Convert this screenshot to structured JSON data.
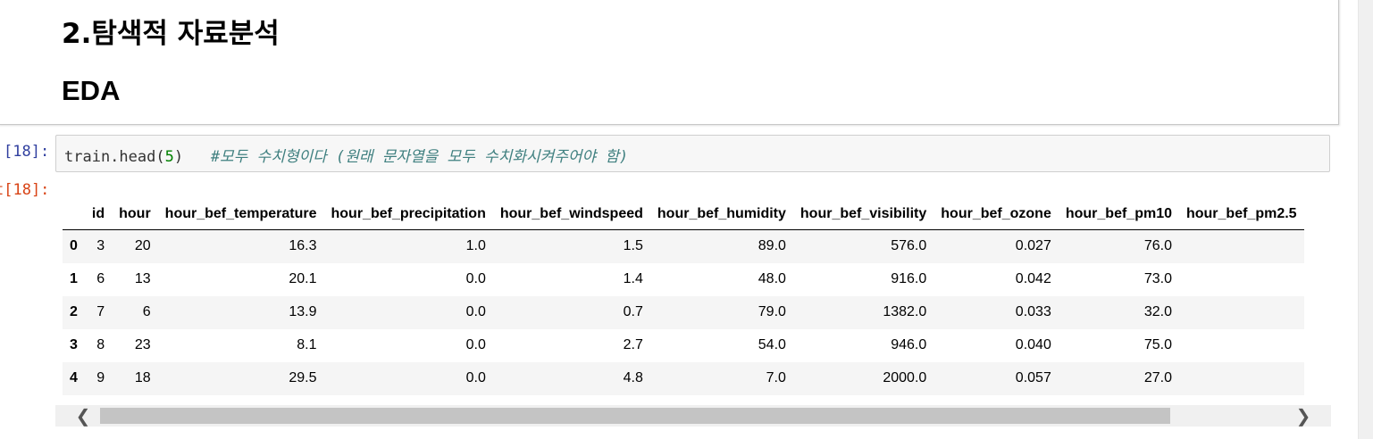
{
  "markdown": {
    "heading1": "2.탐색적 자료분석",
    "heading2": "EDA"
  },
  "input_cell": {
    "prompt": "[18]:",
    "code_prefix": "train.head(",
    "code_arg": "5",
    "code_suffix": ")",
    "code_comment": "#모두 수치형이다 (원래 문자열을 모두 수치화시켜주어야 함)"
  },
  "output_cell": {
    "prompt": "t[18]:"
  },
  "table": {
    "columns": [
      "",
      "id",
      "hour",
      "hour_bef_temperature",
      "hour_bef_precipitation",
      "hour_bef_windspeed",
      "hour_bef_humidity",
      "hour_bef_visibility",
      "hour_bef_ozone",
      "hour_bef_pm10",
      "hour_bef_pm2.5"
    ],
    "rows": [
      [
        "0",
        "3",
        "20",
        "16.3",
        "1.0",
        "1.5",
        "89.0",
        "576.0",
        "0.027",
        "76.0",
        ""
      ],
      [
        "1",
        "6",
        "13",
        "20.1",
        "0.0",
        "1.4",
        "48.0",
        "916.0",
        "0.042",
        "73.0",
        ""
      ],
      [
        "2",
        "7",
        "6",
        "13.9",
        "0.0",
        "0.7",
        "79.0",
        "1382.0",
        "0.033",
        "32.0",
        ""
      ],
      [
        "3",
        "8",
        "23",
        "8.1",
        "0.0",
        "2.7",
        "54.0",
        "946.0",
        "0.040",
        "75.0",
        ""
      ],
      [
        "4",
        "9",
        "18",
        "29.5",
        "0.0",
        "4.8",
        "7.0",
        "2000.0",
        "0.057",
        "27.0",
        ""
      ]
    ]
  },
  "scrollbar": {
    "left_arrow": "❮",
    "right_arrow": "❯"
  }
}
